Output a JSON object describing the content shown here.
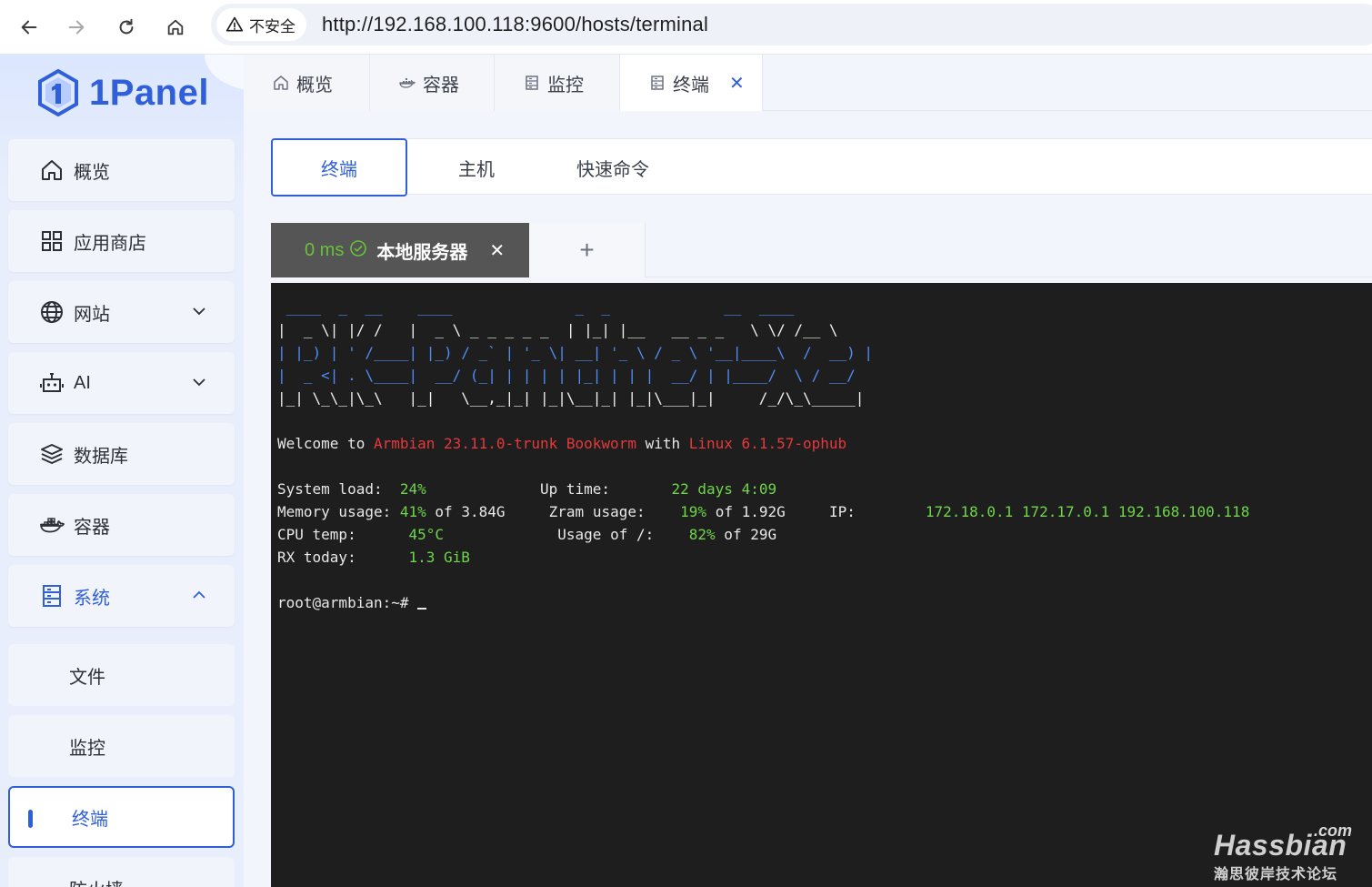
{
  "browser": {
    "security_label": "不安全",
    "url": "http://192.168.100.118:9600/hosts/terminal"
  },
  "sidebar": {
    "logo_text": "1Panel",
    "items": [
      {
        "label": "概览",
        "icon": "home-icon"
      },
      {
        "label": "应用商店",
        "icon": "apps-grid-icon"
      },
      {
        "label": "网站",
        "icon": "globe-icon"
      },
      {
        "label": "AI",
        "icon": "robot-icon"
      },
      {
        "label": "数据库",
        "icon": "database-layers-icon"
      },
      {
        "label": "容器",
        "icon": "docker-icon"
      },
      {
        "label": "系统",
        "icon": "server-icon"
      }
    ],
    "sub_items": [
      "文件",
      "监控",
      "终端",
      "防火墙"
    ],
    "accent_color": "#2f5fd9"
  },
  "page_tabs": [
    {
      "label": "概览"
    },
    {
      "label": "容器"
    },
    {
      "label": "监控"
    },
    {
      "label": "终端"
    }
  ],
  "sub_tabs": [
    "终端",
    "主机",
    "快速命令"
  ],
  "terminal_tab": {
    "latency": "0 ms",
    "name": "本地服务器",
    "add": "+"
  },
  "terminal": {
    "banner": [
      " ____  _  __    ____              _  _             __  ____  ",
      "|  _ \\| |/ /   |  _ \\ _ _ _ _ _  | |_| |__   __ _ _   \\ \\/ /__ \\ ",
      "| |_) | ' /____| |_) / _` | '_ \\| __| '_ \\ / _ \\ '__|____\\  /  __) |",
      "|  _ <| . \\____|  __/ (_| | | | | |_| | | |  __/ | |____/  \\ / __/ ",
      "|_| \\_\\_|\\_\\   |_|   \\__,_|_| |_|\\__|_| |_|\\___|_|     /_/\\_\\_____|"
    ],
    "welcome": {
      "prefix": "Welcome to ",
      "distro": "Armbian 23.11.0-trunk Bookworm",
      "mid": " with ",
      "kernel": "Linux 6.1.57-ophub"
    },
    "stats": {
      "system_load_label": "System load:",
      "system_load": "24%",
      "up_time_label": "Up time:",
      "up_time": "22 days 4:09",
      "memory_label": "Memory usage:",
      "memory_pct": "41%",
      "memory_of": " of 3.84G",
      "zram_label": "Zram usage:",
      "zram_pct": "19%",
      "zram_of": " of 1.92G",
      "ip_label": "IP:",
      "ip": "172.18.0.1 172.17.0.1 192.168.100.118",
      "cpu_label": "CPU temp:",
      "cpu_temp": "45°C",
      "usage_label": "Usage of /:",
      "usage_pct": "82%",
      "usage_of": " of 29G",
      "rx_label": "RX today:",
      "rx": "1.3 GiB"
    },
    "prompt": "root@armbian:~# "
  },
  "watermark": {
    "com": ".com",
    "main": "Hassbian",
    "sub": "瀚思彼岸技术论坛"
  }
}
